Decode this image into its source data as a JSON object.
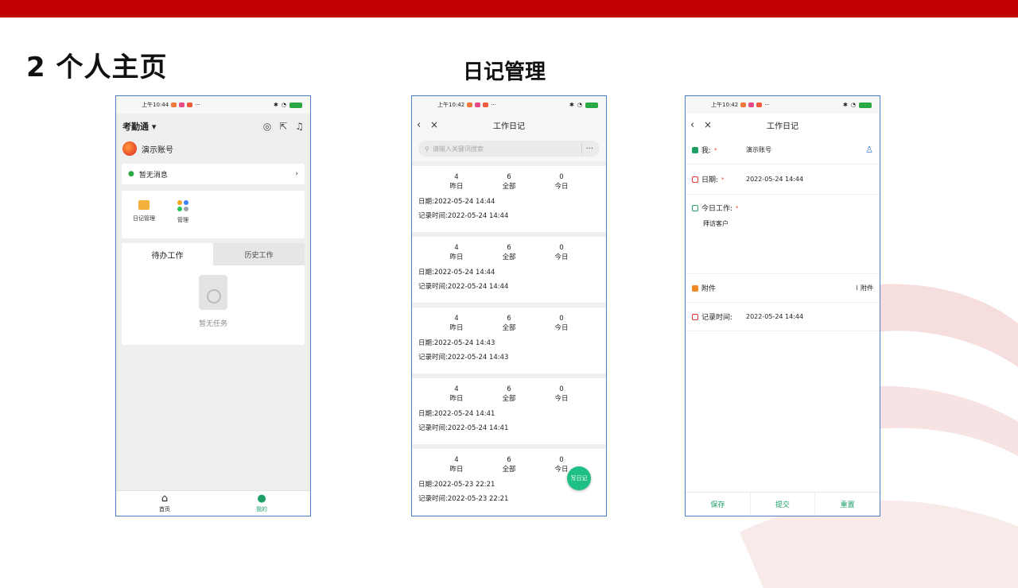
{
  "slide": {
    "title": "2 个人主页",
    "section_title": "日记管理"
  },
  "status": {
    "time": "上午10:44",
    "time2": "上午10:42",
    "dots": "···"
  },
  "home": {
    "app_name": "考勤通",
    "user": "演示账号",
    "message": "暂无消息",
    "apps": [
      {
        "label": "日记管理",
        "icon": "diary-icon"
      },
      {
        "label": "管理",
        "icon": "grid-icon"
      }
    ],
    "tabs": [
      "待办工作",
      "历史工作"
    ],
    "empty_text": "暂无任务",
    "bottom": [
      {
        "label": "首页",
        "icon": "home-icon"
      },
      {
        "label": "我的",
        "icon": "person-icon"
      }
    ]
  },
  "diary_list": {
    "title": "工作日记",
    "search_placeholder": "请输入关键词搜索",
    "stat_labels": [
      "昨日",
      "全部",
      "今日"
    ],
    "entries": [
      {
        "yesterday": "4",
        "all": "6",
        "today": "0",
        "date": "日期:2022-05-24 14:44",
        "record": "记录时间:2022-05-24 14:44"
      },
      {
        "yesterday": "4",
        "all": "6",
        "today": "0",
        "date": "日期:2022-05-24 14:44",
        "record": "记录时间:2022-05-24 14:44"
      },
      {
        "yesterday": "4",
        "all": "6",
        "today": "0",
        "date": "日期:2022-05-24 14:43",
        "record": "记录时间:2022-05-24 14:43"
      },
      {
        "yesterday": "4",
        "all": "6",
        "today": "0",
        "date": "日期:2022-05-24 14:41",
        "record": "记录时间:2022-05-24 14:41"
      },
      {
        "yesterday": "4",
        "all": "6",
        "today": "0",
        "date": "日期:2022-05-23 22:21",
        "record": "记录时间:2022-05-23 22:21"
      }
    ],
    "fab": "写日记"
  },
  "diary_form": {
    "title": "工作日记",
    "me_label": "我:",
    "me_value": "演示账号",
    "date_label": "日期:",
    "date_value": "2022-05-24 14:44",
    "work_label": "今日工作:",
    "work_value": "拜访客户",
    "attach_label": "附件",
    "attach_button": "附件",
    "record_label": "记录时间:",
    "record_value": "2022-05-24 14:44",
    "buttons": [
      "保存",
      "提交",
      "重置"
    ]
  },
  "colors": {
    "brand_red": "#c00000",
    "accent_green": "#1ea064"
  }
}
